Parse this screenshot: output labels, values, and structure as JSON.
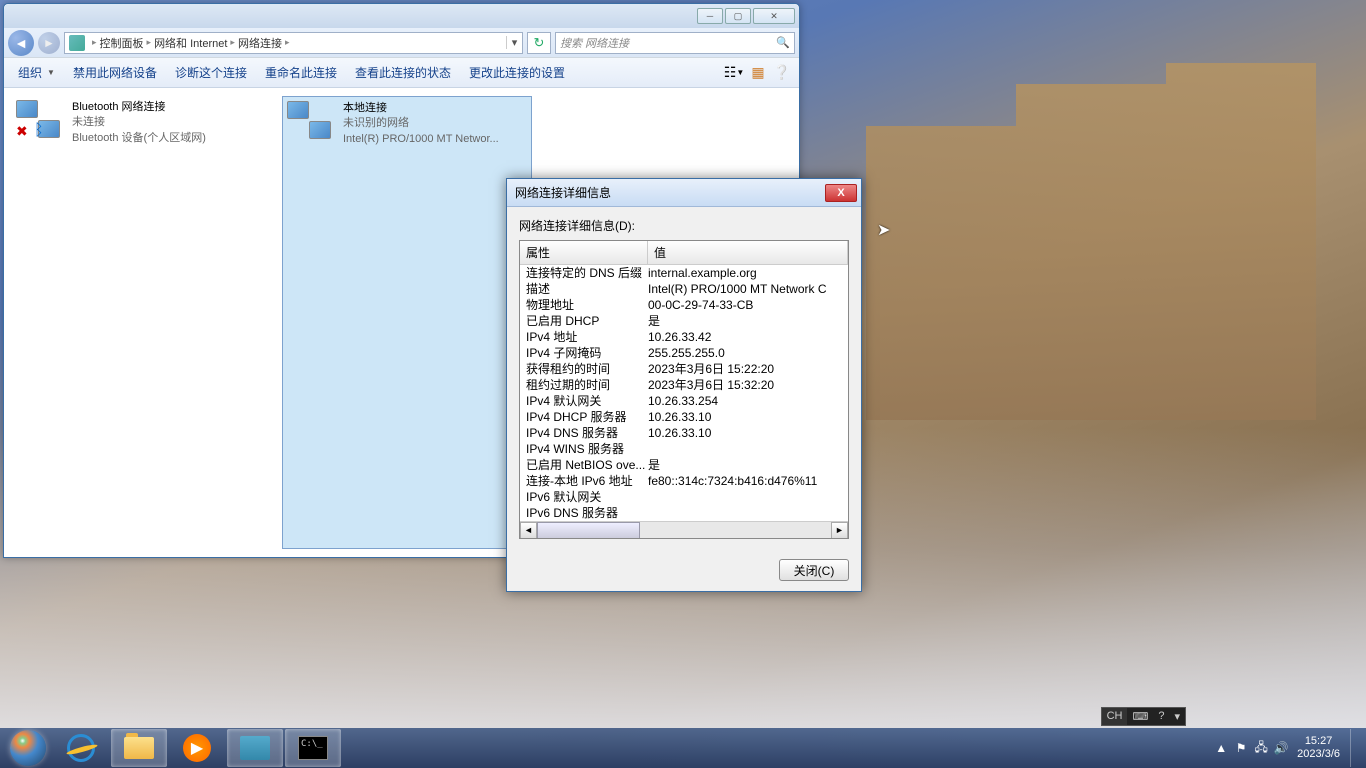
{
  "explorer": {
    "breadcrumb": [
      "控制面板",
      "网络和 Internet",
      "网络连接"
    ],
    "search_placeholder": "搜索 网络连接",
    "toolbar": {
      "organize": "组织",
      "disable": "禁用此网络设备",
      "diagnose": "诊断这个连接",
      "rename": "重命名此连接",
      "view_status": "查看此连接的状态",
      "change_settings": "更改此连接的设置"
    },
    "connections": [
      {
        "title": "Bluetooth 网络连接",
        "status": "未连接",
        "device": "Bluetooth 设备(个人区域网)",
        "overlay_x": true,
        "overlay_bt": true
      },
      {
        "title": "本地连接",
        "status": "未识别的网络",
        "device": "Intel(R) PRO/1000 MT Networ...",
        "selected": true
      }
    ]
  },
  "dialog": {
    "title": "网络连接详细信息",
    "subtitle": "网络连接详细信息(D):",
    "col_prop": "属性",
    "col_val": "值",
    "rows": [
      {
        "p": "连接特定的 DNS 后缀",
        "v": "internal.example.org"
      },
      {
        "p": "描述",
        "v": "Intel(R) PRO/1000 MT Network C"
      },
      {
        "p": "物理地址",
        "v": "00-0C-29-74-33-CB"
      },
      {
        "p": "已启用 DHCP",
        "v": "是"
      },
      {
        "p": "IPv4 地址",
        "v": "10.26.33.42"
      },
      {
        "p": "IPv4 子网掩码",
        "v": "255.255.255.0"
      },
      {
        "p": "获得租约的时间",
        "v": "2023年3月6日 15:22:20"
      },
      {
        "p": "租约过期的时间",
        "v": "2023年3月6日 15:32:20"
      },
      {
        "p": "IPv4 默认网关",
        "v": "10.26.33.254"
      },
      {
        "p": "IPv4 DHCP 服务器",
        "v": "10.26.33.10"
      },
      {
        "p": "IPv4 DNS 服务器",
        "v": "10.26.33.10"
      },
      {
        "p": "IPv4 WINS 服务器",
        "v": ""
      },
      {
        "p": "已启用 NetBIOS ove...",
        "v": "是"
      },
      {
        "p": "连接-本地 IPv6 地址",
        "v": "fe80::314c:7324:b416:d476%11"
      },
      {
        "p": "IPv6 默认网关",
        "v": ""
      },
      {
        "p": "IPv6 DNS 服务器",
        "v": ""
      }
    ],
    "close_btn": "关闭(C)"
  },
  "taskbar": {
    "lang": "CH",
    "time": "15:27",
    "date": "2023/3/6"
  }
}
